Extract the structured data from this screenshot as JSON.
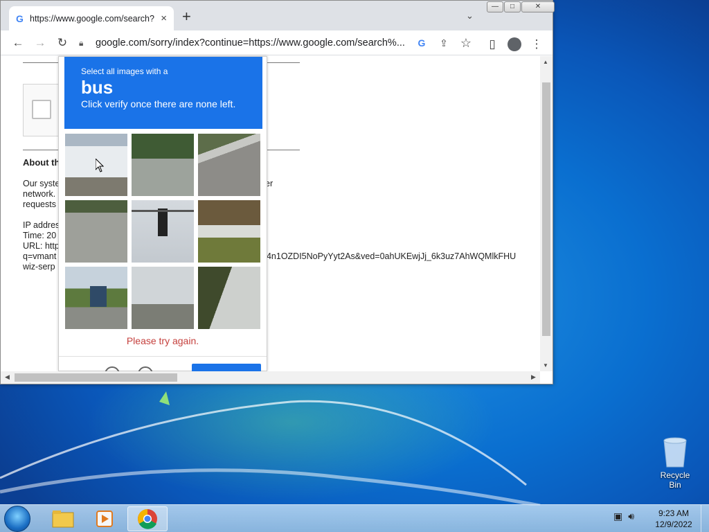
{
  "browser": {
    "tab": {
      "favicon": "G",
      "title": "https://www.google.com/search?",
      "close": "×"
    },
    "new_tab": "+",
    "tab_menu": "⌄",
    "window_controls": {
      "minimize": "—",
      "maximize": "□",
      "close": "✕"
    },
    "nav": {
      "back": "←",
      "forward": "→",
      "reload": "↻"
    },
    "url": "google.com/sorry/index?continue=https://www.google.com/search%...",
    "url_icons": {
      "google": "G",
      "share": "⇪",
      "star": "☆"
    },
    "right_tools": {
      "sidepanel": "▯",
      "profile": "●",
      "menu": "⋮"
    }
  },
  "page": {
    "about_heading": "About th",
    "para1": [
      "Our syste",
      "network.",
      "requests"
    ],
    "para1_right": "er",
    "info": [
      "IP addres",
      "Time: 20",
      "URL: http",
      "q=vmant",
      "wiz-serp"
    ],
    "url_tail": "TY4n1OZDI5NoPyYyt2As&ved=0ahUKEwjJj_6k3uz7AhWQMlkFHU"
  },
  "captcha": {
    "line1": "Select all images with a",
    "target": "bus",
    "line3": "Click verify once there are none left.",
    "error": "Please try again.",
    "tiles": [
      "bus-front",
      "road",
      "guardrail-road",
      "crosswalk",
      "traffic-light",
      "bus-on-road",
      "bus-street",
      "palm-street",
      "palm-tree"
    ]
  },
  "desktop": {
    "recycle_bin": "Recycle Bin"
  },
  "taskbar": {
    "time": "9:23 AM",
    "date": "12/9/2022"
  }
}
